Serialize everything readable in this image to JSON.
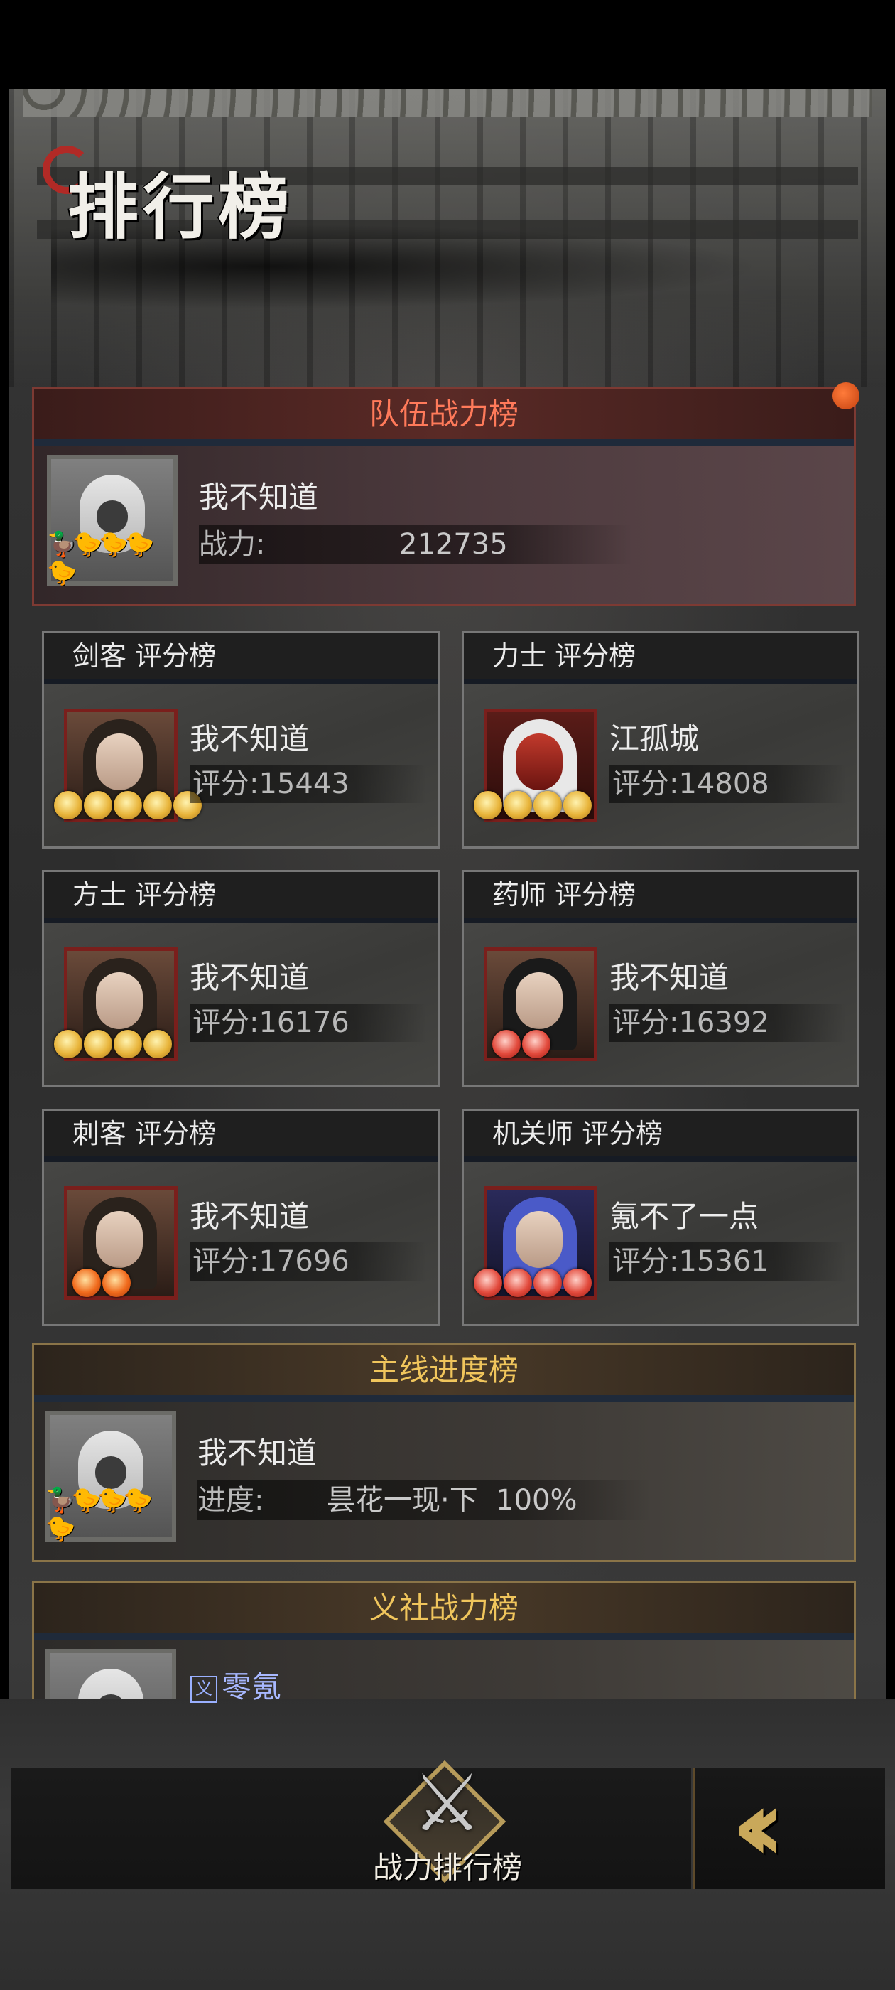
{
  "page_title": "排行榜",
  "team_power": {
    "title": "队伍战力榜",
    "player": "我不知道",
    "stat_label": "战力:",
    "stat_value": "212735"
  },
  "class_boards": [
    {
      "title": "剑客 评分榜",
      "player": "我不知道",
      "score": "评分:15443",
      "stars": 5,
      "star_color": "gold"
    },
    {
      "title": "力士 评分榜",
      "player": "江孤城",
      "score": "评分:14808",
      "stars": 4,
      "star_color": "gold"
    },
    {
      "title": "方士 评分榜",
      "player": "我不知道",
      "score": "评分:16176",
      "stars": 4,
      "star_color": "gold"
    },
    {
      "title": "药师 评分榜",
      "player": "我不知道",
      "score": "评分:16392",
      "stars": 2,
      "star_color": "red"
    },
    {
      "title": "刺客 评分榜",
      "player": "我不知道",
      "score": "评分:17696",
      "stars": 2,
      "star_color": "orange"
    },
    {
      "title": "机关师 评分榜",
      "player": "氪不了一点",
      "score": "评分:15361",
      "stars": 4,
      "star_color": "red"
    }
  ],
  "story_progress": {
    "title": "主线进度榜",
    "player": "我不知道",
    "stat_label": "进度:",
    "stat_value": "昙花一现·下  100%"
  },
  "guild_power": {
    "title": "义社战力榜",
    "guild_tag": "义",
    "guild_name": "零氪"
  },
  "bottom_nav": {
    "active_tab": "战力排行榜"
  },
  "colors": {
    "team_header": "#ff7a5a",
    "story_header": "#f0c55c",
    "guild_name": "#a8b8ff"
  }
}
